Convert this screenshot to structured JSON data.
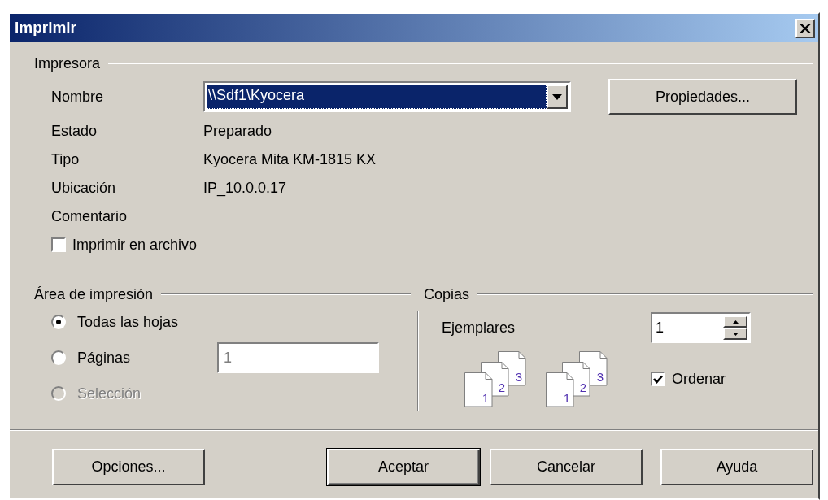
{
  "window": {
    "title": "Imprimir"
  },
  "printer": {
    "title": "Impresora",
    "name_label": "Nombre",
    "name_value": "\\\\Sdf1\\Kyocera",
    "name_highlighted": true,
    "properties_button": "Propiedades...",
    "info": [
      {
        "label": "Estado",
        "value": "Preparado"
      },
      {
        "label": "Tipo",
        "value": "Kyocera Mita KM-1815 KX"
      },
      {
        "label": "Ubicación",
        "value": "IP_10.0.0.17"
      },
      {
        "label": "Comentario"
      }
    ],
    "print_to_file": {
      "label": "Imprimir en archivo",
      "checked": false
    }
  },
  "print_range": {
    "title": "Área de impresión",
    "options": [
      {
        "label": "Todas las hojas",
        "selected": true,
        "disabled": false
      },
      {
        "label": "Páginas",
        "selected": false,
        "disabled": false
      },
      {
        "label": "Selección",
        "selected": false,
        "disabled": true
      }
    ],
    "pages_value": "1"
  },
  "copies": {
    "title": "Copias",
    "count_label": "Ejemplares",
    "count_value": "1",
    "collate_icons": [
      {
        "pages": [
          "1",
          "2",
          "3"
        ]
      },
      {
        "pages": [
          "1",
          "2",
          "3"
        ]
      }
    ],
    "collate": {
      "label": "Ordenar",
      "checked": true
    }
  },
  "buttons": [
    {
      "label": "Opciones...",
      "default": false
    },
    {
      "label": "Aceptar",
      "default": true
    },
    {
      "label": "Cancelar",
      "default": false
    },
    {
      "label": "Ayuda",
      "default": false
    }
  ]
}
